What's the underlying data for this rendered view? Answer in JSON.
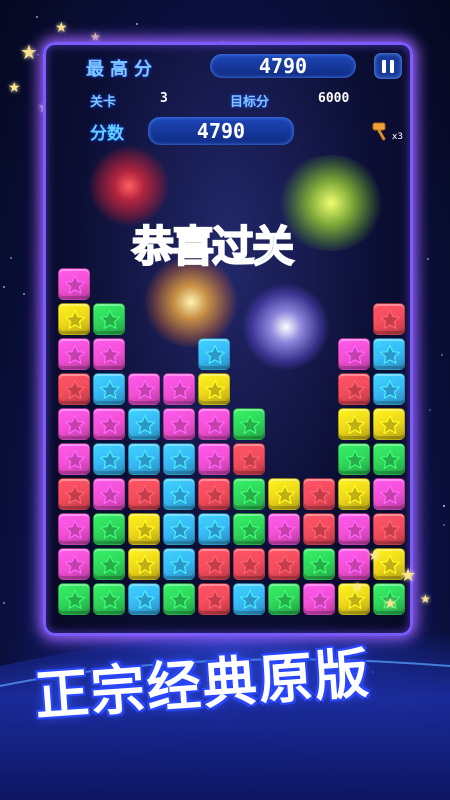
{
  "header": {
    "best_label": "最高分",
    "best_value": "4790",
    "level_label": "关卡",
    "level_value": "3",
    "target_label": "目标分",
    "target_value": "6000",
    "score_label": "分数",
    "score_value": "4790",
    "hammer_count": "x3"
  },
  "celebration": {
    "chars": [
      "恭",
      "喜",
      "过",
      "关"
    ],
    "colors": [
      "#ff2a6a",
      "#ffd21c",
      "#28d84a",
      "#2b8bff"
    ]
  },
  "board": {
    "palette": {
      "P": "#f24fd2",
      "Y": "#ecd51a",
      "G": "#2fd45a",
      "R": "#f24b5a",
      "B": "#37b8f6"
    },
    "rows": [
      "P.........",
      "YG.......R",
      "PP..B...PB",
      "RBPPY...RB",
      "PPBPPG..YY",
      "PBBBPR..GG",
      "RPRBRGYRYP",
      "PGYBBGPRPR",
      "PGYBRRRGPY",
      "GGBGRBGPYG"
    ]
  },
  "banner": {
    "text": "正宗经典原版"
  },
  "colors": {
    "frame": "#7a5cff",
    "pill": "#1d47b8",
    "label": "#7fc8ff"
  }
}
